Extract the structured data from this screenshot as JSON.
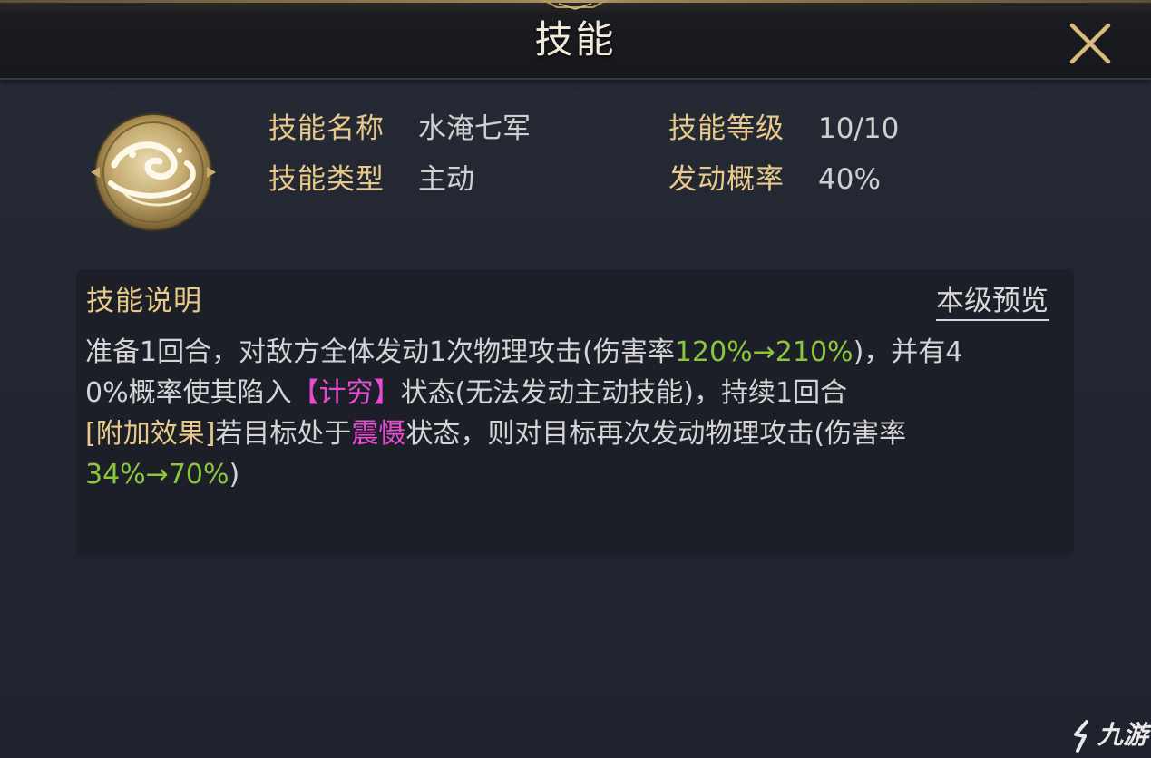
{
  "window": {
    "title": "技能"
  },
  "skill": {
    "icon": "water-wave-icon",
    "name_label": "技能名称",
    "name_value": "水淹七军",
    "level_label": "技能等级",
    "level_value": "10/10",
    "type_label": "技能类型",
    "type_value": "主动",
    "chance_label": "发动概率",
    "chance_value": "40%"
  },
  "description": {
    "title": "技能说明",
    "preview_link": "本级预览",
    "line1": {
      "a": "准备1回合，对敌方全体发动1次物理攻击(伤害率",
      "b": "120%→210%",
      "c": ")，并有4"
    },
    "line2": {
      "a": "0%概率使其陷入",
      "b": "【计穷】",
      "c": "状态(无法发动主动技能)，持续1回合"
    },
    "line3": {
      "a": "[附加效果]",
      "b": "若目标处于",
      "c": "震慑",
      "d": "状态，则对目标再次发动物理攻击(伤害率"
    },
    "line4": {
      "a": "34%→70%",
      "b": ")"
    }
  },
  "watermark": {
    "text": "九游"
  },
  "colors": {
    "label_gold": "#e8c98a",
    "value_gray": "#cfcfcf",
    "highlight_green": "#8ac63e",
    "highlight_magenta": "#e64bd2"
  }
}
